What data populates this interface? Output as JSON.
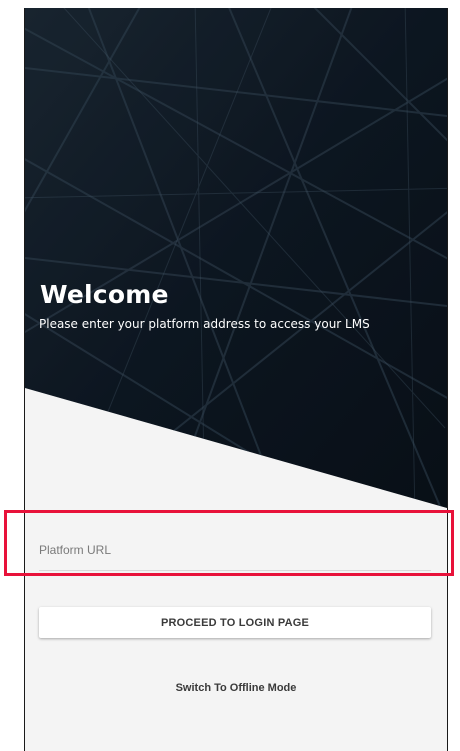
{
  "hero": {
    "title": "Welcome",
    "subtitle": "Please enter your platform address to access your LMS"
  },
  "form": {
    "url_placeholder": "Platform URL",
    "url_value": ""
  },
  "actions": {
    "proceed_label": "PROCEED TO LOGIN PAGE",
    "offline_label": "Switch To Offline Mode"
  },
  "colors": {
    "hero_background": "#0f1a26",
    "screen_background": "#f4f4f4",
    "highlight": "#e8123a"
  }
}
